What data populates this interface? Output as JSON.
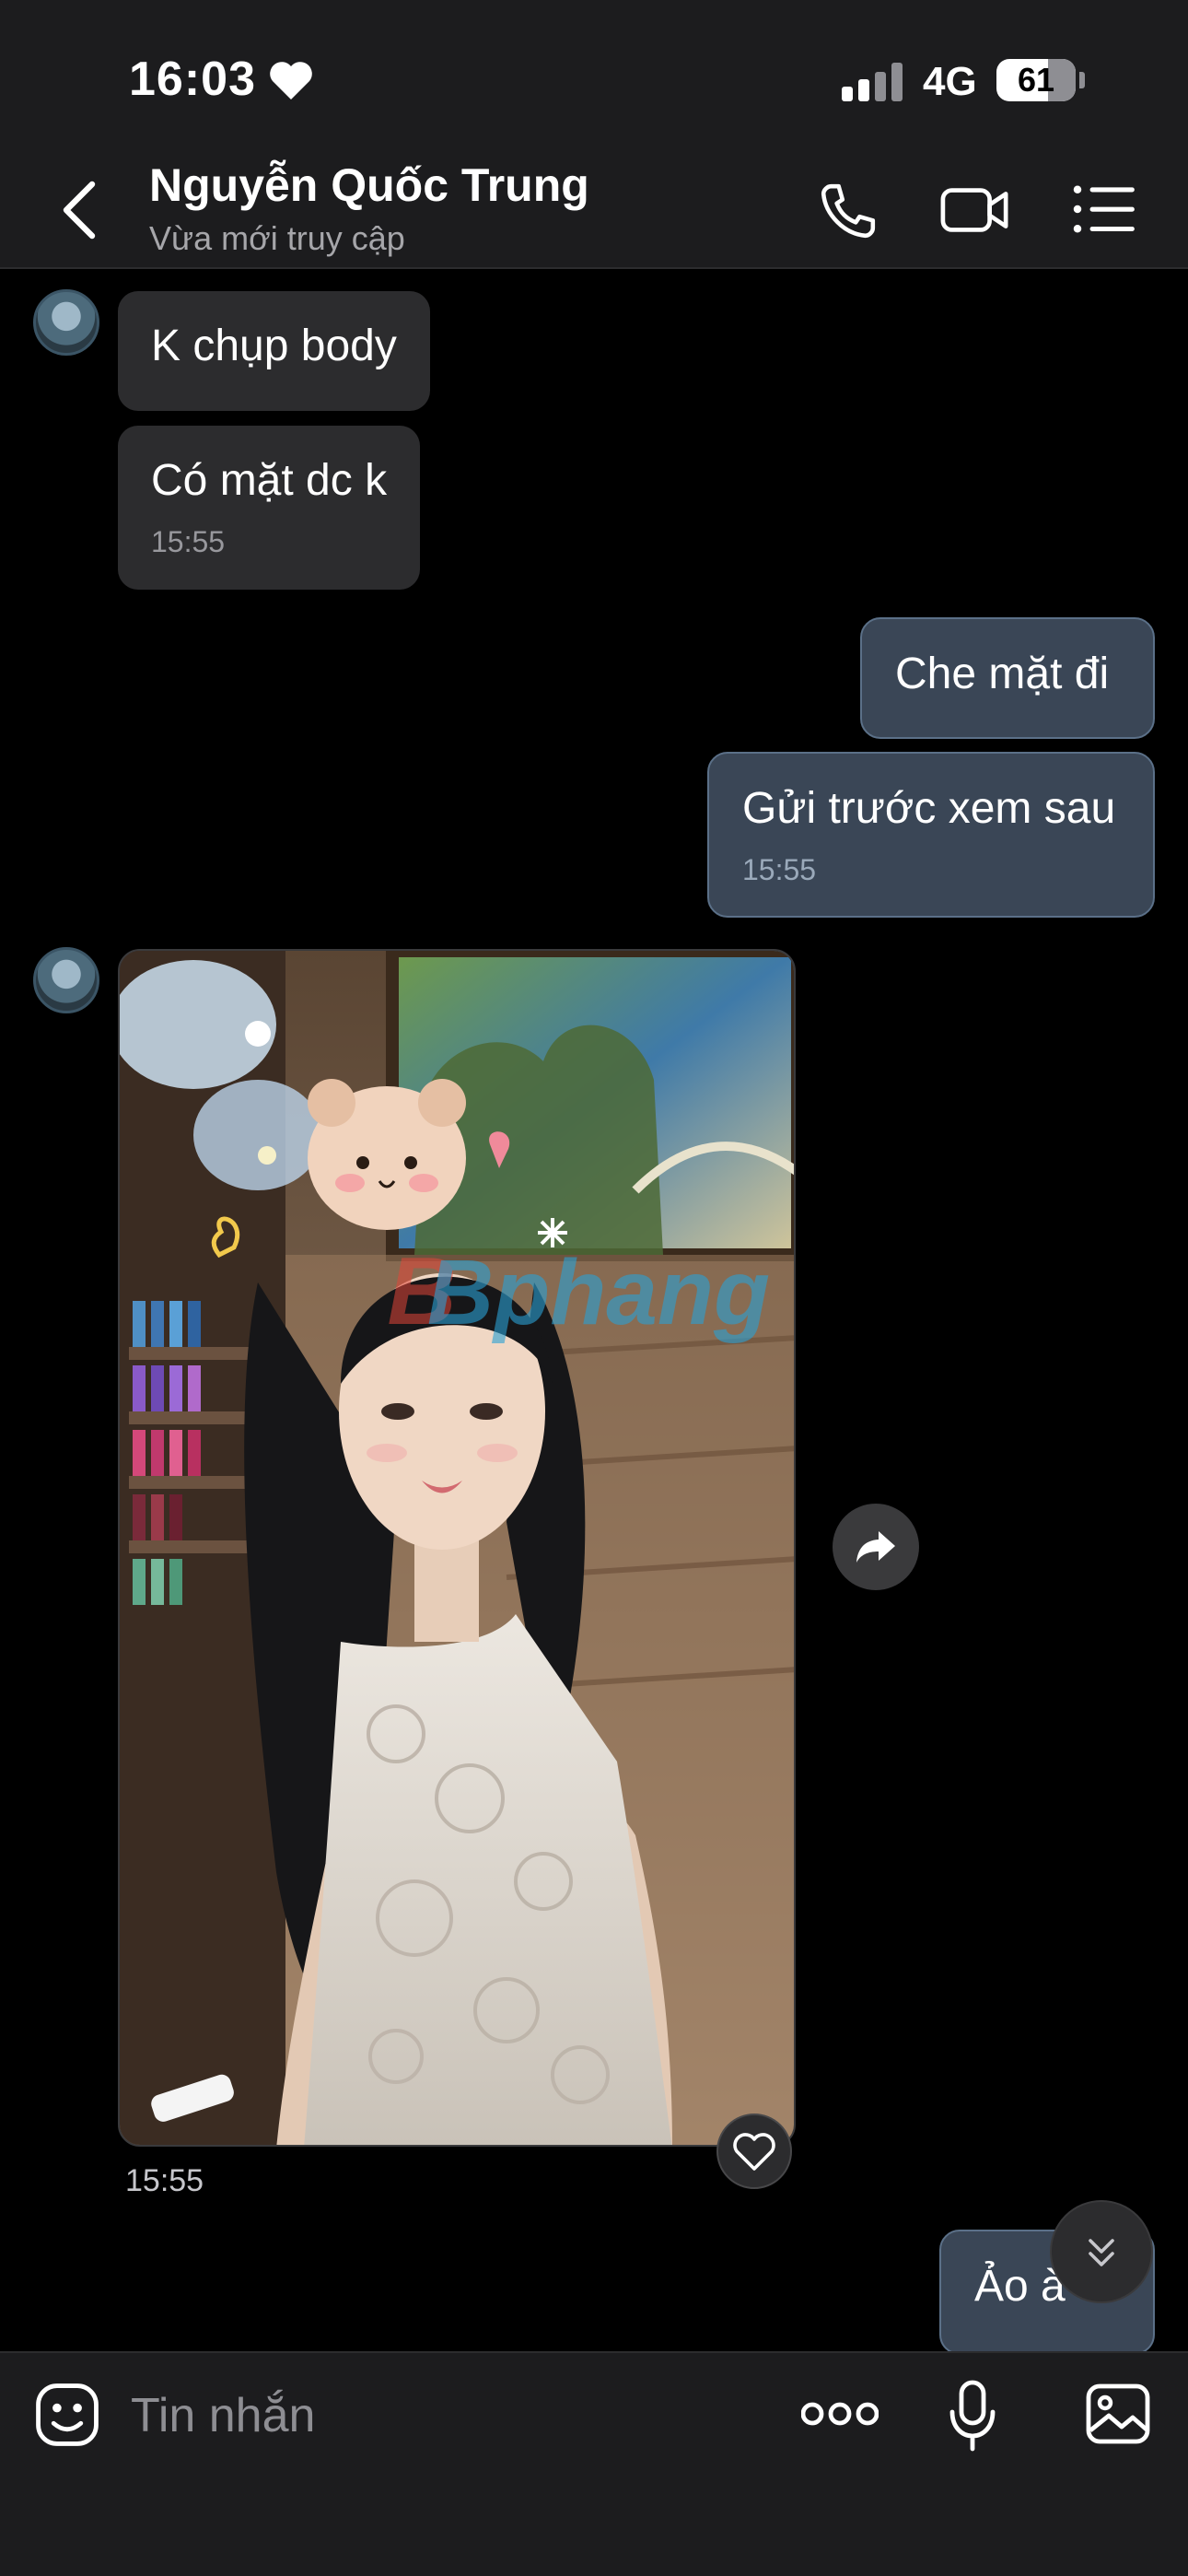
{
  "status_bar": {
    "time": "16:03",
    "network": "4G",
    "battery": "61"
  },
  "header": {
    "contact_name": "Nguyễn Quốc Trung",
    "contact_status": "Vừa mới truy cập"
  },
  "messages": [
    {
      "from": "contact",
      "text": "K chụp body"
    },
    {
      "from": "contact",
      "text": "Có mặt dc k",
      "time": "15:55"
    },
    {
      "from": "me",
      "text": "Che mặt đi"
    },
    {
      "from": "me",
      "text": "Gửi trước xem sau",
      "time": "15:55"
    },
    {
      "from": "contact",
      "type": "photo",
      "time": "15:55",
      "watermark": "Bphang"
    },
    {
      "from": "me",
      "text": "Ảo à"
    }
  ],
  "composer": {
    "placeholder": "Tin nhắn"
  },
  "icons": {
    "back": "chevron-left-icon",
    "call": "phone-icon",
    "video": "video-camera-icon",
    "menu": "list-menu-icon",
    "emoji": "emoji-icon",
    "more": "more-dots-icon",
    "mic": "microphone-icon",
    "gallery": "image-icon",
    "share": "share-arrow-icon",
    "like": "heart-icon",
    "scroll": "chevron-double-down-icon"
  },
  "colors": {
    "background": "#000000",
    "header": "#1c1c1e",
    "incoming_bubble": "#2c2c2e",
    "outgoing_bubble": "#3a4656"
  }
}
